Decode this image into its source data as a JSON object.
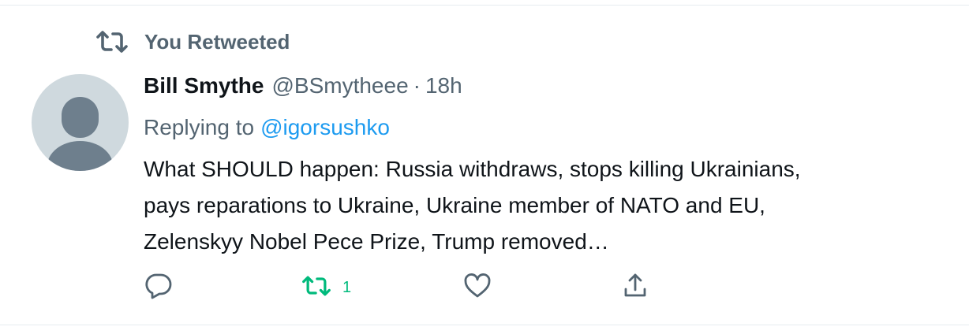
{
  "retweet_context": {
    "label": "You Retweeted"
  },
  "tweet": {
    "author": {
      "name": "Bill Smythe",
      "handle": "@BSmytheee"
    },
    "separator": "·",
    "time": "18h",
    "replying_prefix": "Replying to",
    "replying_to": "@igorsushko",
    "text_lines": [
      "What SHOULD happen: Russia withdraws, stops killing Ukrainians,",
      "pays reparations to Ukraine, Ukraine member of NATO and EU,",
      "Zelenskyy Nobel Pece Prize, Trump removed…"
    ],
    "actions": {
      "reply_icon": "reply-icon",
      "retweet_icon": "retweet-icon",
      "retweet_count": "1",
      "like_icon": "heart-icon",
      "share_icon": "share-icon"
    }
  },
  "colors": {
    "text_primary": "#0f1419",
    "text_secondary": "#536471",
    "link": "#1d9bf0",
    "retweet_active": "#00ba7c",
    "avatar_bg": "#cfd9de",
    "avatar_fg": "#6e7f8d"
  }
}
